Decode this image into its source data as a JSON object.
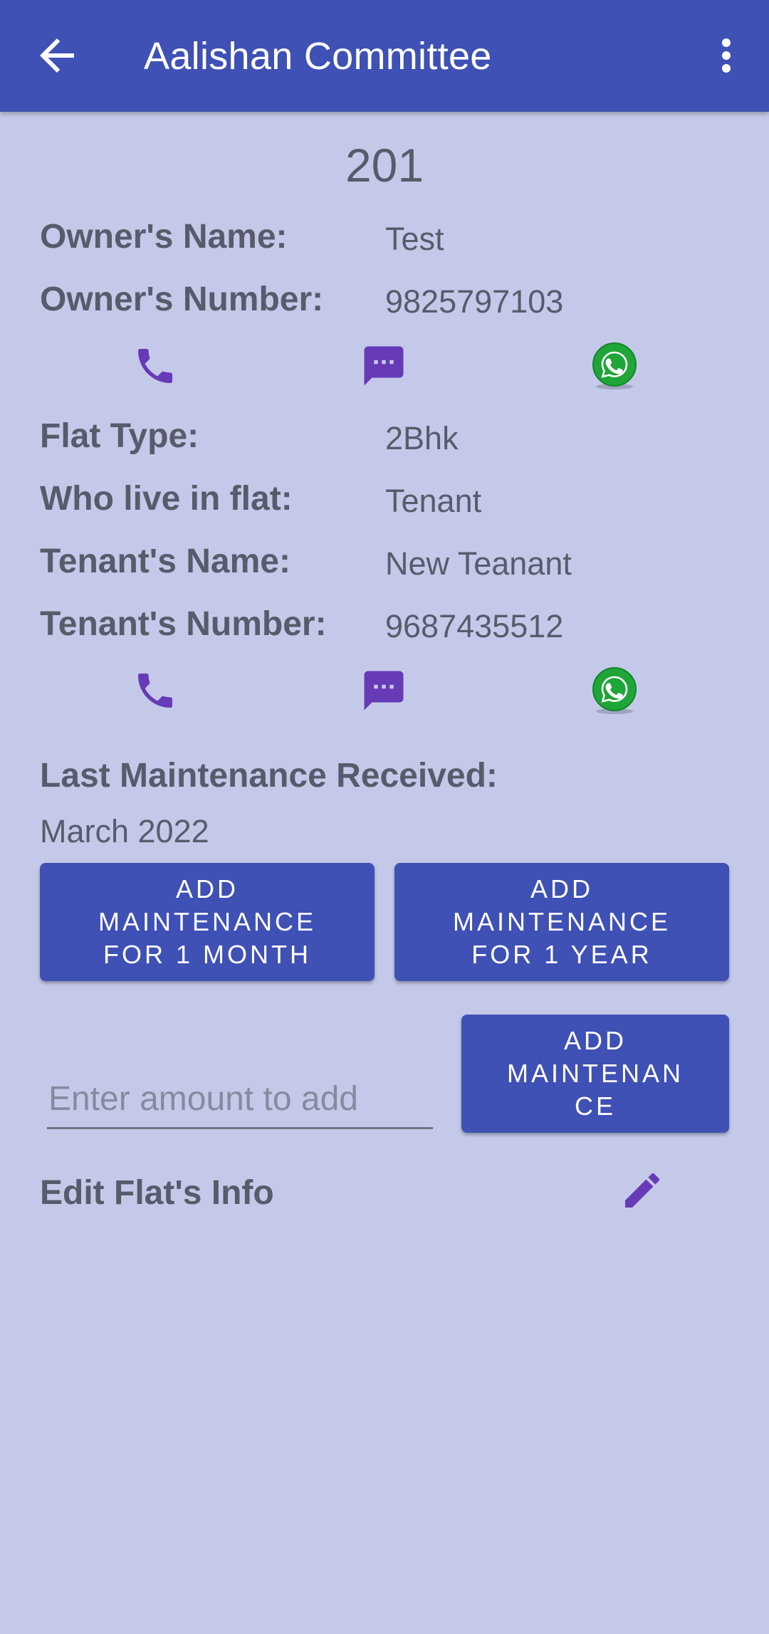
{
  "appbar": {
    "title": "Aalishan Committee",
    "back_icon": "arrow-back-icon",
    "menu_icon": "more-vert-icon"
  },
  "flat": {
    "number": "201",
    "owner_name_label": "Owner's Name:",
    "owner_name": "Test",
    "owner_number_label": "Owner's Number:",
    "owner_number": "9825797103",
    "flat_type_label": "Flat Type:",
    "flat_type": "2Bhk",
    "who_lives_label": "Who live in flat:",
    "who_lives": "Tenant",
    "tenant_name_label": "Tenant's Name:",
    "tenant_name": "New Teanant",
    "tenant_number_label": "Tenant's Number:",
    "tenant_number": "9687435512"
  },
  "contact_icons": [
    "phone-icon",
    "message-icon",
    "whatsapp-icon"
  ],
  "maintenance": {
    "last_received_label": "Last Maintenance Received:",
    "last_received": "March 2022",
    "btn_month": "ADD\nMAINTENANCE\nFOR 1 MONTH",
    "btn_year": "ADD\nMAINTENANCE\nFOR 1 YEAR",
    "amount_placeholder": "Enter amount to add",
    "amount_value": "",
    "btn_add": "ADD\nMAINTENAN\nCE"
  },
  "edit": {
    "label": "Edit Flat's Info",
    "icon": "edit-pencil-icon"
  },
  "colors": {
    "primary": "#3f51b5",
    "background": "#c5c9e9",
    "icon_purple": "#673ab7",
    "whatsapp_green": "#1fa538",
    "text": "#585b6b"
  }
}
